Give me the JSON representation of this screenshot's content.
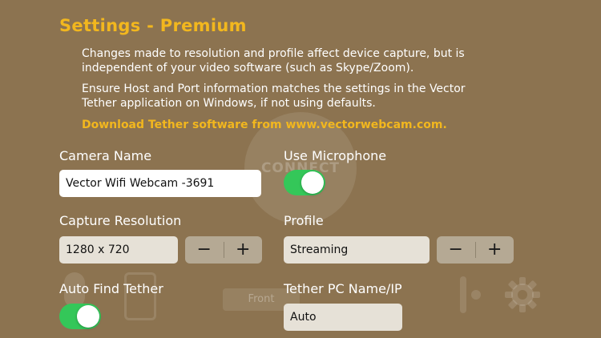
{
  "title": "Settings - Premium",
  "info": {
    "paragraph1": "Changes made to resolution and profile affect device capture, but is independent of your video software (such as Skype/Zoom).",
    "paragraph2": "Ensure Host and Port information matches the settings in the Vector Tether application on Windows, if not using defaults.",
    "download_link": "Download Tether software from www.vectorwebcam.com."
  },
  "camera_name": {
    "label": "Camera Name",
    "value": "Vector Wifi Webcam -3691"
  },
  "use_microphone": {
    "label": "Use Microphone",
    "on": true
  },
  "capture_resolution": {
    "label": "Capture Resolution",
    "value": "1280 x 720",
    "decrement": "−",
    "increment": "+"
  },
  "profile": {
    "label": "Profile",
    "value": "Streaming",
    "decrement": "−",
    "increment": "+"
  },
  "auto_find_tether": {
    "label": "Auto Find Tether",
    "on": true
  },
  "tether_pc": {
    "label": "Tether PC Name/IP",
    "value": "Auto"
  },
  "background": {
    "connect_label": "CONNECT",
    "front_label": "Front"
  },
  "colors": {
    "accent": "#f2b71e",
    "background": "#8c7350",
    "toggle_on": "#34c759"
  }
}
